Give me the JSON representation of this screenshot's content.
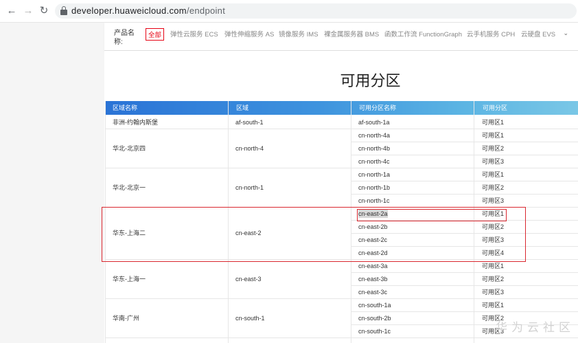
{
  "browser": {
    "url_domain": "developer.huaweicloud.com",
    "url_path": "/endpoint",
    "back_icon": "back-arrow-icon",
    "forward_icon": "forward-arrow-icon",
    "reload_icon": "reload-icon"
  },
  "filter": {
    "label": "产品名称:",
    "chips": [
      "全部",
      "弹性云服务 ECS",
      "弹性伸缩服务 AS",
      "镜像服务 IMS",
      "裸金属服务器 BMS",
      "函数工作流 FunctionGraph",
      "云手机服务 CPH",
      "云硬盘 EVS"
    ],
    "more_icon": "chevron-down-icon"
  },
  "title": "可用分区",
  "table": {
    "headers": [
      "区域名称",
      "区域",
      "可用分区名称",
      "可用分区"
    ],
    "groups": [
      {
        "region_name": "非洲-约翰内斯堡",
        "region": "af-south-1",
        "zones": [
          [
            "af-south-1a",
            "可用区1"
          ]
        ]
      },
      {
        "region_name": "华北-北京四",
        "region": "cn-north-4",
        "zones": [
          [
            "cn-north-4a",
            "可用区1"
          ],
          [
            "cn-north-4b",
            "可用区2"
          ],
          [
            "cn-north-4c",
            "可用区3"
          ]
        ]
      },
      {
        "region_name": "华北-北京一",
        "region": "cn-north-1",
        "zones": [
          [
            "cn-north-1a",
            "可用区1"
          ],
          [
            "cn-north-1b",
            "可用区2"
          ],
          [
            "cn-north-1c",
            "可用区3"
          ]
        ]
      },
      {
        "region_name": "华东-上海二",
        "region": "cn-east-2",
        "zones": [
          [
            "cn-east-2a",
            "可用区1"
          ],
          [
            "cn-east-2b",
            "可用区2"
          ],
          [
            "cn-east-2c",
            "可用区3"
          ],
          [
            "cn-east-2d",
            "可用区4"
          ]
        ]
      },
      {
        "region_name": "华东-上海一",
        "region": "cn-east-3",
        "zones": [
          [
            "cn-east-3a",
            "可用区1"
          ],
          [
            "cn-east-3b",
            "可用区2"
          ],
          [
            "cn-east-3c",
            "可用区3"
          ]
        ]
      },
      {
        "region_name": "华南-广州",
        "region": "cn-south-1",
        "zones": [
          [
            "cn-south-1a",
            "可用区1"
          ],
          [
            "cn-south-2b",
            "可用区2"
          ],
          [
            "cn-south-1c",
            "可用区3"
          ]
        ]
      }
    ]
  },
  "watermark": "华为云社区",
  "colors": {
    "annotation_red": "#d9262e",
    "active_chip": "#e60012",
    "header_start": "#2a73d6",
    "header_end": "#7ac7e6"
  }
}
